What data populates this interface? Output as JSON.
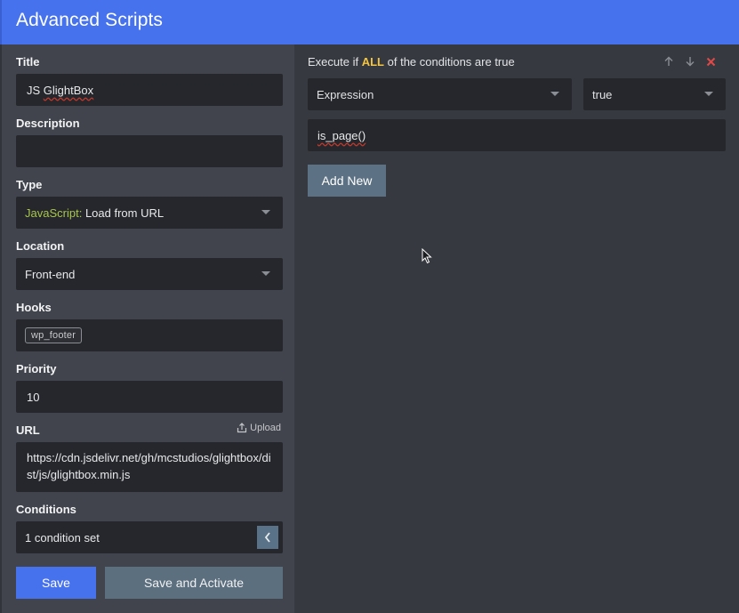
{
  "header": {
    "title": "Advanced Scripts"
  },
  "form": {
    "title": {
      "label": "Title",
      "value": "JS GlightBox"
    },
    "description": {
      "label": "Description",
      "value": ""
    },
    "type": {
      "label": "Type",
      "value_prefix": "JavaScript:",
      "value": "Load from URL"
    },
    "location": {
      "label": "Location",
      "value": "Front-end"
    },
    "hooks": {
      "label": "Hooks",
      "tags": [
        "wp_footer"
      ]
    },
    "priority": {
      "label": "Priority",
      "value": "10"
    },
    "url": {
      "label": "URL",
      "upload_label": "Upload",
      "value": "https://cdn.jsdelivr.net/gh/mcstudios/glightbox/dist/js/glightbox.min.js"
    },
    "conditions": {
      "label": "Conditions",
      "value": "1 condition set"
    },
    "save_label": "Save",
    "save_activate_label": "Save and Activate"
  },
  "conditions_panel": {
    "execute_prefix": "Execute if",
    "execute_mode": "ALL",
    "execute_suffix": "of the conditions are true",
    "condition_type": "Expression",
    "condition_result": "true",
    "expression": "is_page()",
    "add_new_label": "Add New"
  },
  "colors": {
    "accent": "#4772ee",
    "secondary_button": "#5c6f7f",
    "highlight": "#f4c542",
    "js_keyword": "#a8c64a",
    "delete": "#e04848"
  }
}
